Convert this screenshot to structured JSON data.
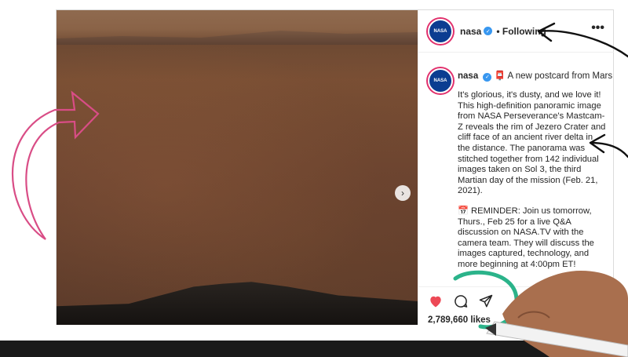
{
  "post": {
    "username": "nasa",
    "follow_status": "• Following",
    "more": "•••",
    "avatar_text": "NASA",
    "caption": {
      "username": "nasa",
      "headline": "📮 A new postcard from Mars",
      "paragraph1": "It's glorious, it's dusty, and we love it! This high-definition panoramic image from NASA Perseverance's Mastcam-Z reveals the rim of Jezero Crater and cliff face of an ancient river delta in the distance. The panorama was stitched together from 142 individual images taken on Sol 3, the third Martian day of the mission (Feb. 21, 2021).",
      "paragraph2": "📅 REMINDER: Join us tomorrow, Thurs., Feb 25 for a live Q&A discussion on NASA.TV with the camera team. They will discuss the images captured, technology, and more beginning at 4:00pm ET!"
    },
    "likes": "2,789,660 likes",
    "next_glyph": "›"
  },
  "colors": {
    "like": "#ed4956",
    "verified": "#3897f0",
    "annotation_pink": "#d94d86",
    "annotation_green": "#2bb38a"
  },
  "icons": [
    "heart-icon",
    "comment-icon",
    "share-icon",
    "verified-icon",
    "more-icon",
    "chevron-right-icon"
  ]
}
